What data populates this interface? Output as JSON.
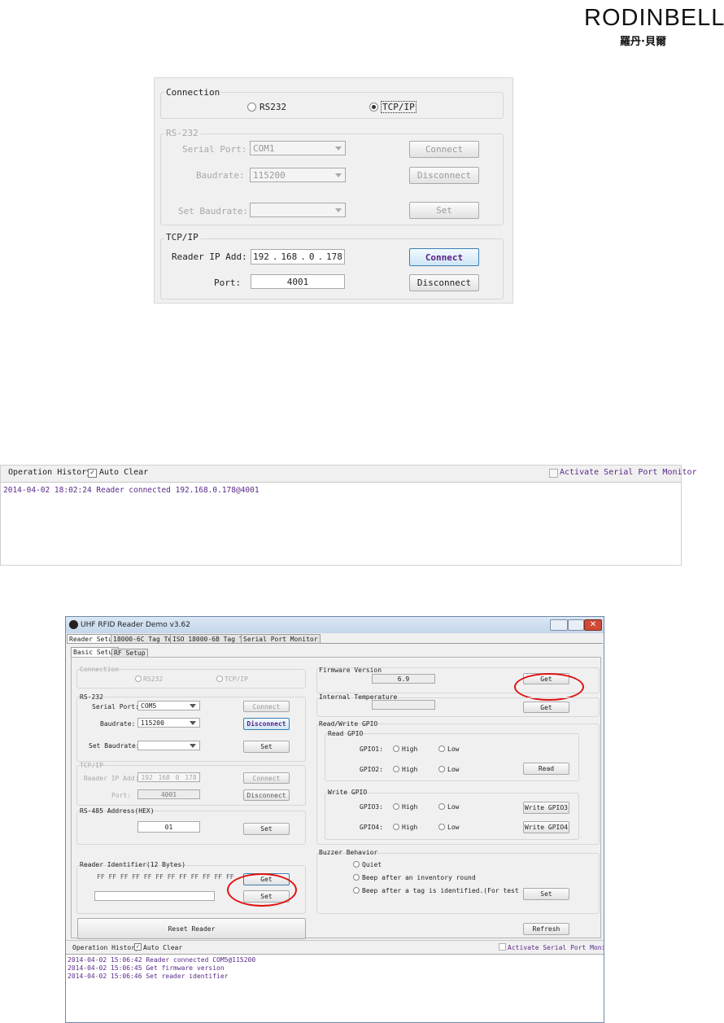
{
  "logo": {
    "text": "RODINBELL",
    "cn": "羅丹·貝爾"
  },
  "panel1": {
    "connection": {
      "title": "Connection",
      "rs232": "RS232",
      "tcpip": "TCP/IP"
    },
    "rs232": {
      "title": "RS-232",
      "serial_port_label": "Serial Port:",
      "serial_port_value": "COM1",
      "baudrate_label": "Baudrate:",
      "baudrate_value": "115200",
      "set_baudrate_label": "Set Baudrate:",
      "connect": "Connect",
      "disconnect": "Disconnect",
      "set": "Set"
    },
    "tcp": {
      "title": "TCP/IP",
      "ip_label": "Reader IP Add:",
      "ip": [
        "192",
        "168",
        "0",
        "178"
      ],
      "port_label": "Port:",
      "port_value": "4001",
      "connect": "Connect",
      "disconnect": "Disconnect"
    }
  },
  "panel2": {
    "history_label": "Operation History:",
    "auto_clear": "Auto Clear",
    "monitor": "Activate Serial Port Monitor",
    "log": [
      "2014-04-02 18:02:24 Reader connected  192.168.0.178@4001"
    ]
  },
  "panel3": {
    "window_title": "UHF RFID Reader Demo v3.62",
    "tabs": [
      "Reader Setup",
      "18000-6C Tag Test",
      "ISO 18000-6B Tag Test",
      "Serial Port Monitor"
    ],
    "subtabs": [
      "Basic Setup",
      "RF Setup"
    ],
    "connection": {
      "title": "Connection",
      "rs232": "RS232",
      "tcpip": "TCP/IP"
    },
    "rs232": {
      "title": "RS-232",
      "serial_port_label": "Serial Port:",
      "serial_port_value": "COM5",
      "baudrate_label": "Baudrate:",
      "baudrate_value": "115200",
      "set_baudrate_label": "Set Baudrate:",
      "connect": "Connect",
      "disconnect": "Disconnect",
      "set": "Set"
    },
    "tcp": {
      "title": "TCP/IP",
      "ip_label": "Reader IP Add:",
      "ip": [
        "192",
        "168",
        "0",
        "178"
      ],
      "port_label": "Port:",
      "port_value": "4001",
      "connect": "Connect",
      "disconnect": "Disconnect"
    },
    "rs485": {
      "title": "RS-485 Address(HEX)",
      "value": "01",
      "set": "Set"
    },
    "identifier": {
      "title": "Reader Identifier(12 Bytes)",
      "value": "FF FF FF FF FF FF FF FF FF FF FF FF",
      "get": "Get",
      "set": "Set"
    },
    "reset": "Reset Reader",
    "firmware": {
      "title": "Firmware Version",
      "value": "6.9",
      "get": "Get"
    },
    "temperature": {
      "title": "Internal Temperature",
      "get": "Get"
    },
    "gpio": {
      "title": "Read/Write GPIO",
      "read_title": "Read GPIO",
      "write_title": "Write GPIO",
      "gpio1": "GPIO1:",
      "gpio2": "GPIO2:",
      "gpio3": "GPIO3:",
      "gpio4": "GPIO4:",
      "high": "High",
      "low": "Low",
      "read": "Read",
      "write3": "Write GPIO3",
      "write4": "Write GPIO4"
    },
    "buzzer": {
      "title": "Buzzer Behavior",
      "quiet": "Quiet",
      "beep_round": "Beep after an inventory round",
      "beep_tag": "Beep after a tag is identified.(For test only)",
      "set": "Set"
    },
    "refresh": "Refresh",
    "history_label": "Operation History:",
    "auto_clear": "Auto Clear",
    "monitor": "Activate Serial Port Monitor",
    "log": [
      "2014-04-02 15:06:42 Reader connected COM5@115200",
      "2014-04-02 15:06:45 Get firmware version",
      "2014-04-02 15:06:46 Set reader identifier"
    ]
  }
}
